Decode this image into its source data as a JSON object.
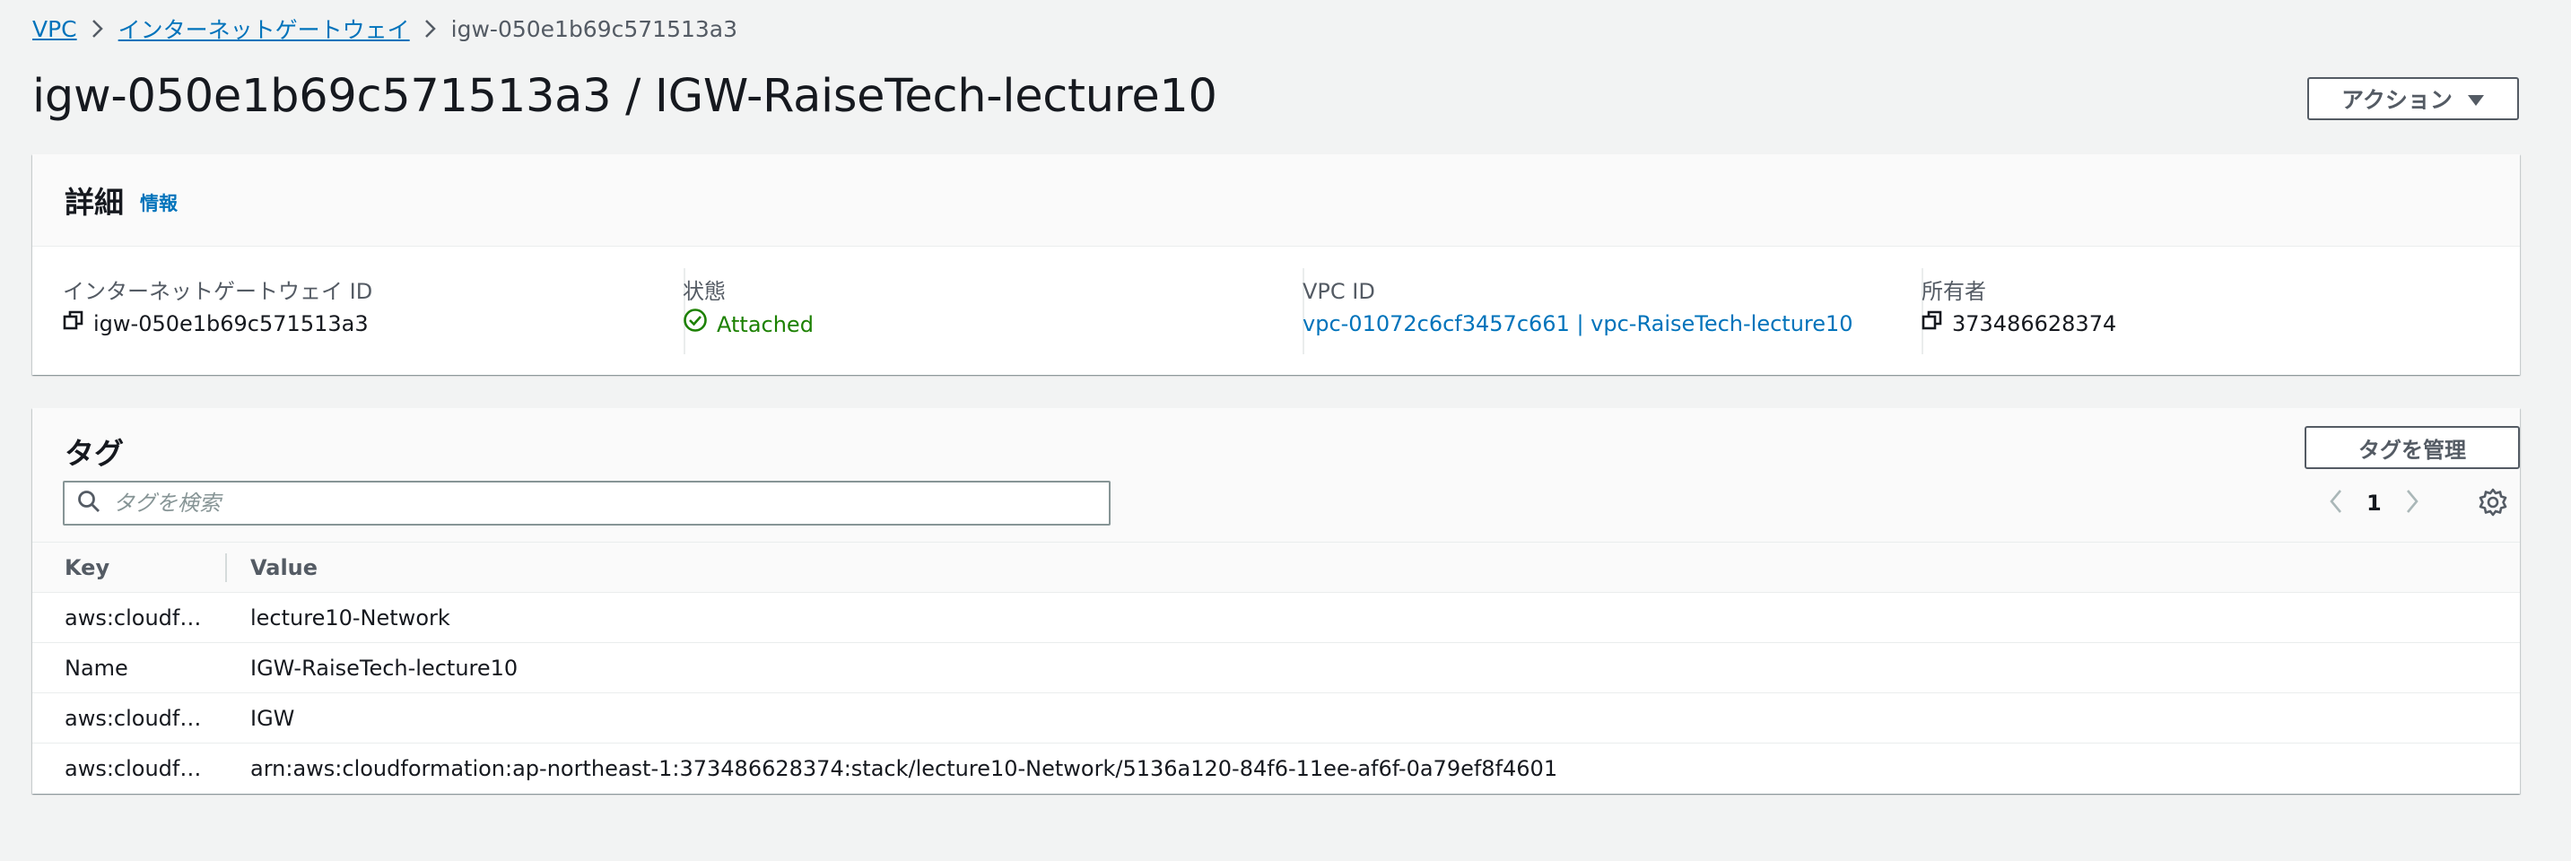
{
  "breadcrumb": {
    "items": [
      "VPC",
      "インターネットゲートウェイ"
    ],
    "current": "igw-050e1b69c571513a3"
  },
  "header": {
    "title": "igw-050e1b69c571513a3 / IGW-RaiseTech-lecture10",
    "actions_label": "アクション"
  },
  "details": {
    "title": "詳細",
    "info_label": "情報",
    "fields": [
      {
        "label": "インターネットゲートウェイ ID",
        "value": "igw-050e1b69c571513a3"
      },
      {
        "label": "状態",
        "value": "Attached"
      },
      {
        "label": "VPC ID",
        "value": "vpc-01072c6cf3457c661 | vpc-RaiseTech-lecture10"
      },
      {
        "label": "所有者",
        "value": "373486628374"
      }
    ]
  },
  "tags": {
    "title": "タグ",
    "manage_label": "タグを管理",
    "search_placeholder": "タグを検索",
    "page": "1",
    "columns": [
      "Key",
      "Value"
    ],
    "rows": [
      {
        "key": "aws:cloudf…",
        "value": "lecture10-Network"
      },
      {
        "key": "Name",
        "value": "IGW-RaiseTech-lecture10"
      },
      {
        "key": "aws:cloudf…",
        "value": "IGW"
      },
      {
        "key": "aws:cloudf…",
        "value": "arn:aws:cloudformation:ap-northeast-1:373486628374:stack/lecture10-Network/5136a120-84f6-11ee-af6f-0a79ef8f4601"
      }
    ]
  },
  "colors": {
    "link": "#0073bb",
    "success": "#1d8102",
    "background": "#f2f3f3",
    "text": "#16191f",
    "secondary_text": "#545b64"
  }
}
